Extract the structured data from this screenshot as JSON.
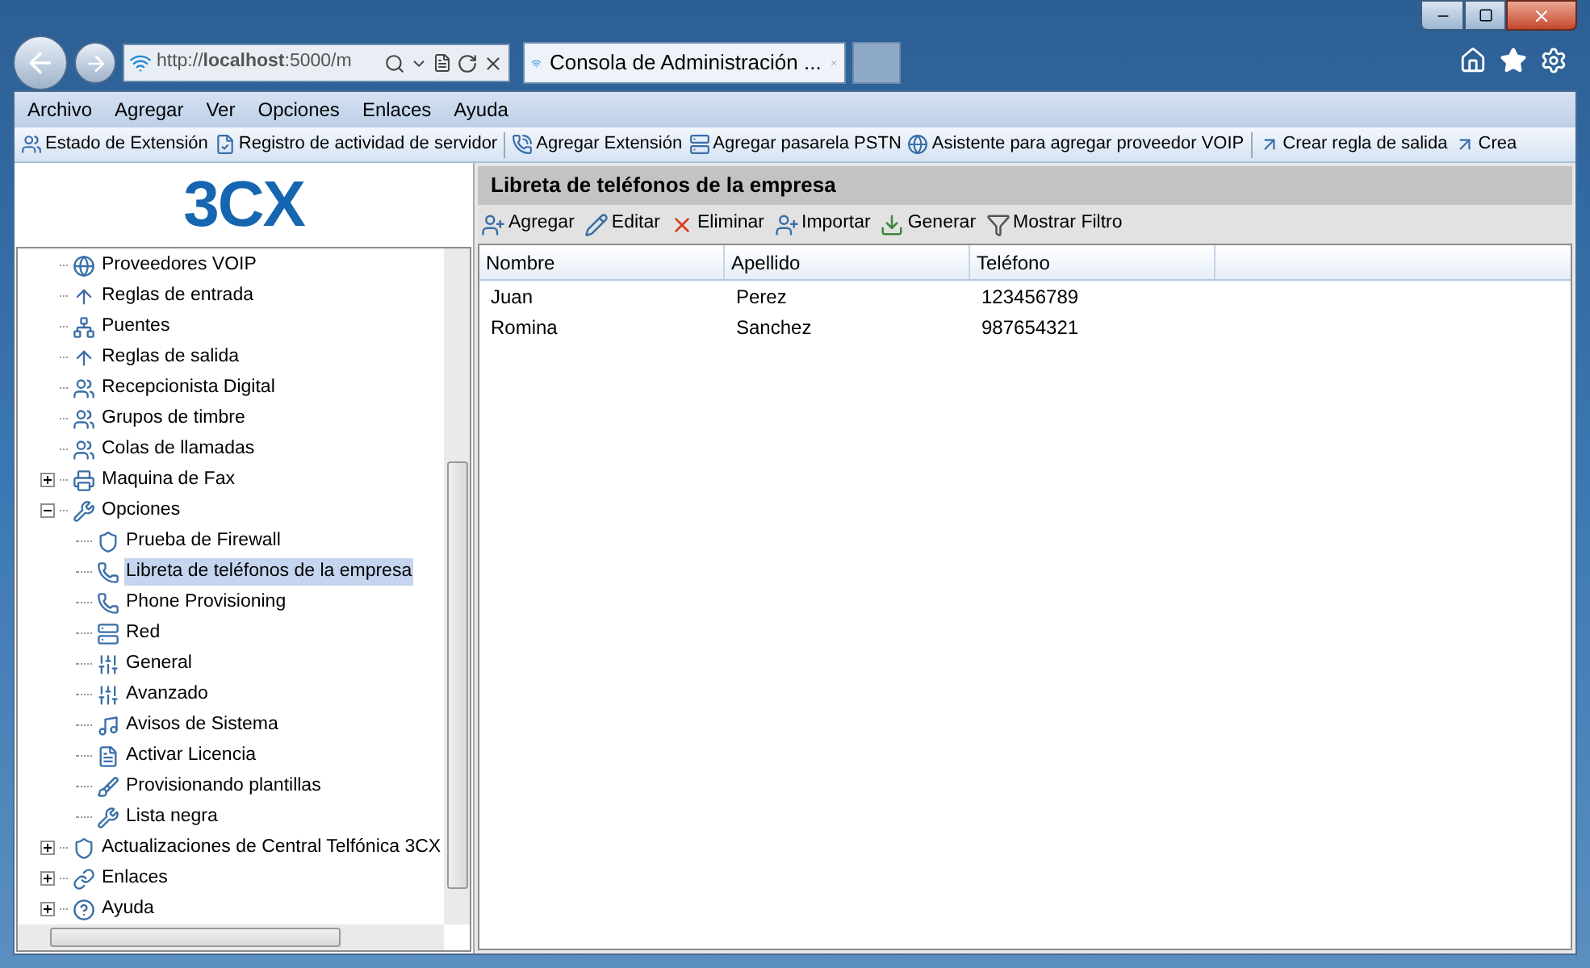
{
  "browser": {
    "address": "http://**localhost**:5000/m",
    "tab_title": "Consola de Administración ..."
  },
  "menu": [
    "Archivo",
    "Agregar",
    "Ver",
    "Opciones",
    "Enlaces",
    "Ayuda"
  ],
  "toolbar_groups": [
    [
      "Estado de Extensión",
      "Registro de actividad de servidor"
    ],
    [
      "Agregar Extensión",
      "Agregar pasarela PSTN",
      "Asistente para agregar proveedor VOIP"
    ],
    [
      "Crear regla de salida",
      "Crea"
    ]
  ],
  "logo": "3CX",
  "tree": [
    {
      "label": "Proveedores VOIP",
      "selected": false
    },
    {
      "label": "Reglas de entrada",
      "selected": false
    },
    {
      "label": "Puentes",
      "selected": false
    },
    {
      "label": "Reglas de salida",
      "selected": false
    },
    {
      "label": "Recepcionista Digital",
      "selected": false
    },
    {
      "label": "Grupos de timbre",
      "selected": false
    },
    {
      "label": "Colas de llamadas",
      "selected": false
    },
    {
      "label": "Maquina de Fax",
      "selected": false,
      "expanded": false
    },
    {
      "label": "Opciones",
      "selected": false,
      "expanded": true,
      "children": [
        {
          "label": "Prueba de Firewall",
          "selected": false
        },
        {
          "label": "Libreta de teléfonos de la empresa",
          "selected": true
        },
        {
          "label": "Phone Provisioning",
          "selected": false
        },
        {
          "label": "Red",
          "selected": false
        },
        {
          "label": "General",
          "selected": false
        },
        {
          "label": "Avanzado",
          "selected": false
        },
        {
          "label": "Avisos de Sistema",
          "selected": false
        },
        {
          "label": "Activar Licencia",
          "selected": false
        },
        {
          "label": "Provisionando plantillas",
          "selected": false
        },
        {
          "label": "Lista negra",
          "selected": false
        }
      ]
    },
    {
      "label": "Actualizaciones de Central Telfónica 3CX",
      "selected": false,
      "expanded": false
    },
    {
      "label": "Enlaces",
      "selected": false,
      "expanded": false
    },
    {
      "label": "Ayuda",
      "selected": false,
      "expanded": false
    }
  ],
  "panel": {
    "title": "Libreta de teléfonos de la empresa",
    "actions": [
      "Agregar",
      "Editar",
      "Eliminar",
      "Importar",
      "Generar",
      "Mostrar Filtro"
    ],
    "table": {
      "columns": [
        "Nombre",
        "Apellido",
        "Teléfono"
      ],
      "rows": [
        [
          "Juan",
          "Perez",
          "123456789"
        ],
        [
          "Romina",
          "Sanchez",
          "987654321"
        ]
      ]
    }
  }
}
